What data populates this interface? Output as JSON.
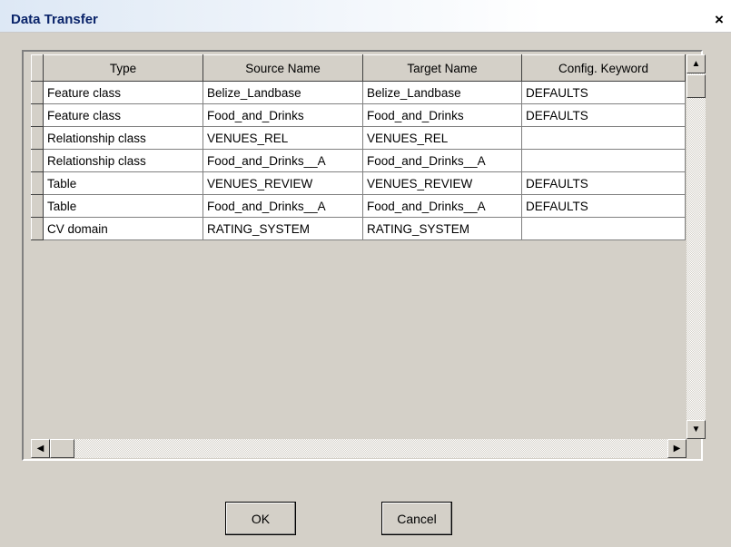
{
  "window": {
    "title": "Data Transfer",
    "close_glyph": "×"
  },
  "grid": {
    "columns": [
      "Type",
      "Source Name",
      "Target Name",
      "Config. Keyword"
    ],
    "rows": [
      {
        "type": "Feature class",
        "source": "Belize_Landbase",
        "target": "Belize_Landbase",
        "keyword": "DEFAULTS"
      },
      {
        "type": "Feature class",
        "source": "Food_and_Drinks",
        "target": "Food_and_Drinks",
        "keyword": "DEFAULTS"
      },
      {
        "type": "Relationship class",
        "source": "VENUES_REL",
        "target": "VENUES_REL",
        "keyword": ""
      },
      {
        "type": "Relationship class",
        "source": "Food_and_Drinks__A",
        "target": "Food_and_Drinks__A",
        "keyword": ""
      },
      {
        "type": "Table",
        "source": "VENUES_REVIEW",
        "target": "VENUES_REVIEW",
        "keyword": "DEFAULTS"
      },
      {
        "type": "Table",
        "source": "Food_and_Drinks__A",
        "target": "Food_and_Drinks__A",
        "keyword": "DEFAULTS"
      },
      {
        "type": "CV domain",
        "source": "RATING_SYSTEM",
        "target": "RATING_SYSTEM",
        "keyword": ""
      }
    ]
  },
  "scrollbars": {
    "up_glyph": "▲",
    "down_glyph": "▼",
    "left_glyph": "◀",
    "right_glyph": "▶"
  },
  "buttons": {
    "ok_label": "OK",
    "cancel_label": "Cancel"
  },
  "colors": {
    "dialog_bg": "#d4d0c8",
    "title_text": "#0a246a",
    "cell_bg": "#ffffff"
  }
}
